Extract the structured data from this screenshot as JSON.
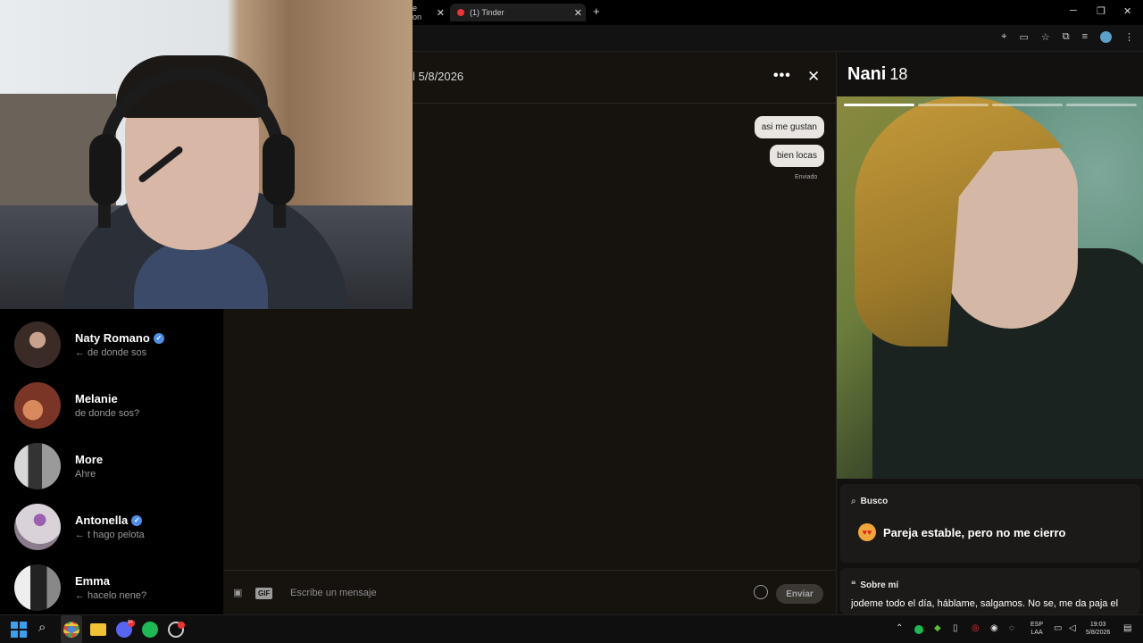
{
  "browser": {
    "tab1_title": "e on",
    "tab2_title": "(1) Tinder",
    "new_tab": "+",
    "close": "✕",
    "window_controls": {
      "minimize": "─",
      "maximize": "❐",
      "close": "✕"
    }
  },
  "chat": {
    "match_date": "l 5/8/2026",
    "more_icon": "•••",
    "close_icon": "✕",
    "messages": [
      {
        "text": "asi me gustan"
      },
      {
        "text": "bien locas"
      }
    ],
    "status": "Enviado",
    "input_placeholder": "Escribe un mensaje",
    "gif_label": "GIF",
    "send_label": "Enviar"
  },
  "matches": [
    {
      "name": "Naty Romano",
      "last_message": "← de donde sos",
      "verified": true,
      "avatar_color": "#3a2b26"
    },
    {
      "name": "Melanie",
      "last_message": "de donde sos?",
      "verified": false,
      "avatar_color": "#7a3526"
    },
    {
      "name": "More",
      "last_message": "Ahre",
      "verified": false,
      "avatar_color": "#6a6a6a"
    },
    {
      "name": "Antonella",
      "last_message": "← t hago pelota",
      "verified": true,
      "avatar_color": "#8a7c8a"
    },
    {
      "name": "Emma",
      "last_message": "← hacelo nene?",
      "verified": false,
      "avatar_color": "#4a4a4a"
    }
  ],
  "profile": {
    "name": "Nani",
    "age": "18",
    "photo_count": 4,
    "photo_index": 1,
    "looking_label": "Busco",
    "looking_value": "Pareja estable, pero no me cierro",
    "about_label": "Sobre mí",
    "about_text": "jodeme todo el día, háblame, salgamos. No se, me da paja el"
  },
  "taskbar": {
    "lang_line1": "ESP",
    "lang_line2": "LAA",
    "time": "19:03",
    "date": "5/8/2026",
    "discord_badge": "9+"
  },
  "colors": {
    "verified": "#4f8fe8",
    "chat_bg": "#16130f",
    "bubble_bg": "#e9e6e1"
  }
}
